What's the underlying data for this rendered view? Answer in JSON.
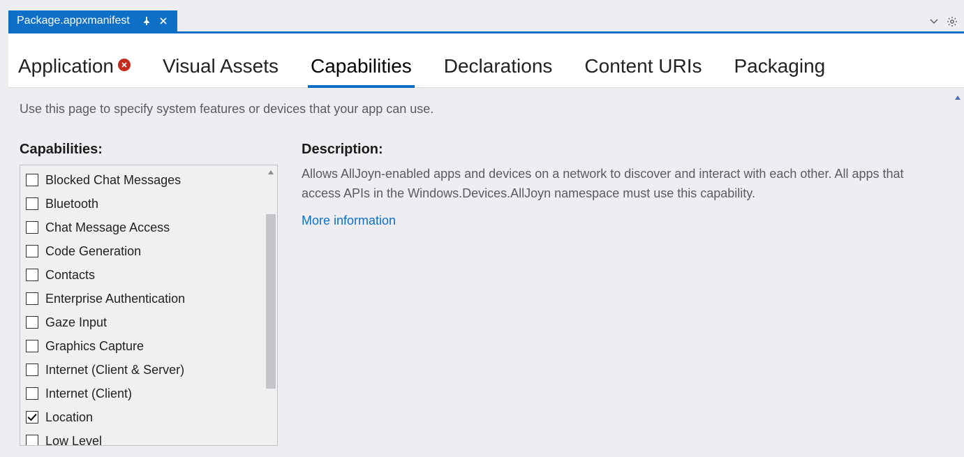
{
  "document_tab": {
    "title": "Package.appxmanifest"
  },
  "nav_tabs": {
    "application": "Application",
    "visual_assets": "Visual Assets",
    "capabilities": "Capabilities",
    "declarations": "Declarations",
    "content_uris": "Content URIs",
    "packaging": "Packaging"
  },
  "hint": "Use this page to specify system features or devices that your app can use.",
  "capabilities_heading": "Capabilities:",
  "description_heading": "Description:",
  "description_text": "Allows AllJoyn-enabled apps and devices on a network to discover and interact with each other. All apps that access APIs in the Windows.Devices.AllJoyn namespace must use this capability.",
  "more_info_label": "More information",
  "capabilities_list": [
    {
      "label": "Blocked Chat Messages",
      "checked": false
    },
    {
      "label": "Bluetooth",
      "checked": false
    },
    {
      "label": "Chat Message Access",
      "checked": false
    },
    {
      "label": "Code Generation",
      "checked": false
    },
    {
      "label": "Contacts",
      "checked": false
    },
    {
      "label": "Enterprise Authentication",
      "checked": false
    },
    {
      "label": "Gaze Input",
      "checked": false
    },
    {
      "label": "Graphics Capture",
      "checked": false
    },
    {
      "label": "Internet (Client & Server)",
      "checked": false
    },
    {
      "label": "Internet (Client)",
      "checked": false
    },
    {
      "label": "Location",
      "checked": true
    },
    {
      "label": "Low Level",
      "checked": false
    }
  ]
}
